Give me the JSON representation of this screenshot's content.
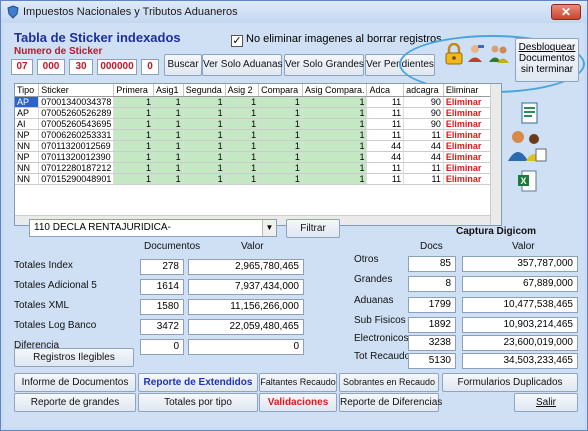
{
  "window": {
    "title": "Impuestos Nacionales y Tributos Aduaneros",
    "close": "✕"
  },
  "heading": "Tabla de Sticker indexados",
  "no_delete": {
    "checked": "✓",
    "label": "No eliminar imagenes al borrar registros"
  },
  "numero_sticker": {
    "label": "Numero de Sticker",
    "parts": [
      "07",
      "000",
      "30",
      "000000",
      "0"
    ]
  },
  "toolbar": {
    "buscar": "Buscar",
    "ver_aduanas": "Ver Solo Aduanas",
    "ver_grandes": "Ver Solo Grandes",
    "ver_pendientes": "Ver Pendientes"
  },
  "desbloquear": {
    "line1": "Desbloquear",
    "line2": "Documentos",
    "line3": "sin terminar"
  },
  "grid": {
    "columns": [
      "Tipo",
      "Sticker",
      "Primera",
      "Asig1",
      "Segunda",
      "Asig 2",
      "Compara",
      "Asig Compara.",
      "Adca",
      "adcagra",
      "Eliminar"
    ],
    "rows": [
      [
        "AP",
        "07001340034378",
        "1",
        "1",
        "1",
        "1",
        "1",
        "1",
        "11",
        "90",
        "Eliminar"
      ],
      [
        "AP",
        "07005260526289",
        "1",
        "1",
        "1",
        "1",
        "1",
        "1",
        "11",
        "90",
        "Eliminar"
      ],
      [
        "AI",
        "07005260543695",
        "1",
        "1",
        "1",
        "1",
        "1",
        "1",
        "11",
        "90",
        "Eliminar"
      ],
      [
        "NP",
        "07006260253331",
        "1",
        "1",
        "1",
        "1",
        "1",
        "1",
        "11",
        "11",
        "Eliminar"
      ],
      [
        "NN",
        "07011320012569",
        "1",
        "1",
        "1",
        "1",
        "1",
        "1",
        "44",
        "44",
        "Eliminar"
      ],
      [
        "NP",
        "07011320012390",
        "1",
        "1",
        "1",
        "1",
        "1",
        "1",
        "44",
        "44",
        "Eliminar"
      ],
      [
        "NN",
        "07012280187212",
        "1",
        "1",
        "1",
        "1",
        "1",
        "1",
        "11",
        "11",
        "Eliminar"
      ],
      [
        "NN",
        "07015290048901",
        "1",
        "1",
        "1",
        "1",
        "1",
        "1",
        "11",
        "11",
        "Eliminar"
      ]
    ]
  },
  "filter": {
    "selected": "110 DECLA RENTAJURIDICA-",
    "button": "Filtrar"
  },
  "captura": "Captura Digicom",
  "left_summary": {
    "col_docs": "Documentos",
    "col_valor": "Valor",
    "rows": [
      {
        "label": "Totales  Index",
        "docs": "278",
        "valor": "2,965,780,465"
      },
      {
        "label": "Totales  Adicional 5",
        "docs": "1614",
        "valor": "7,937,434,000"
      },
      {
        "label": "Totales  XML",
        "docs": "1580",
        "valor": "11,156,266,000"
      },
      {
        "label": "Totales  Log Banco",
        "docs": "3472",
        "valor": "22,059,480,465"
      },
      {
        "label": "Diferencia",
        "docs": "0",
        "valor": "0"
      }
    ]
  },
  "right_summary": {
    "col_docs": "Docs",
    "col_valor": "Valor",
    "rows": [
      {
        "label": "Otros",
        "docs": "85",
        "valor": "357,787,000"
      },
      {
        "label": "Grandes",
        "docs": "8",
        "valor": "67,889,000"
      },
      {
        "label": "Aduanas",
        "docs": "1799",
        "valor": "10,477,538,465"
      },
      {
        "label": "Sub Fisicos",
        "docs": "1892",
        "valor": "10,903,214,465"
      },
      {
        "label": "Electronicos",
        "docs": "3238",
        "valor": "23,600,019,000"
      },
      {
        "label": "Tot Recaudo",
        "docs": "5130",
        "valor": "34,503,233,465"
      }
    ]
  },
  "bottom": {
    "registros": "Registros Ilegibles",
    "informe": "Informe de Documentos",
    "reporte_ext": "Reporte de Extendidos",
    "faltantes": "Faltantes Recaudo",
    "sobrantes": "Sobrantes en Recaudo",
    "formularios": "Formularios Duplicados",
    "reporte_grandes": "Reporte de grandes",
    "totales_tipo": "Totales por tipo",
    "validaciones": "Validaciones",
    "reporte_dif": "Reporte de Diferencias",
    "salir": "Salir"
  }
}
